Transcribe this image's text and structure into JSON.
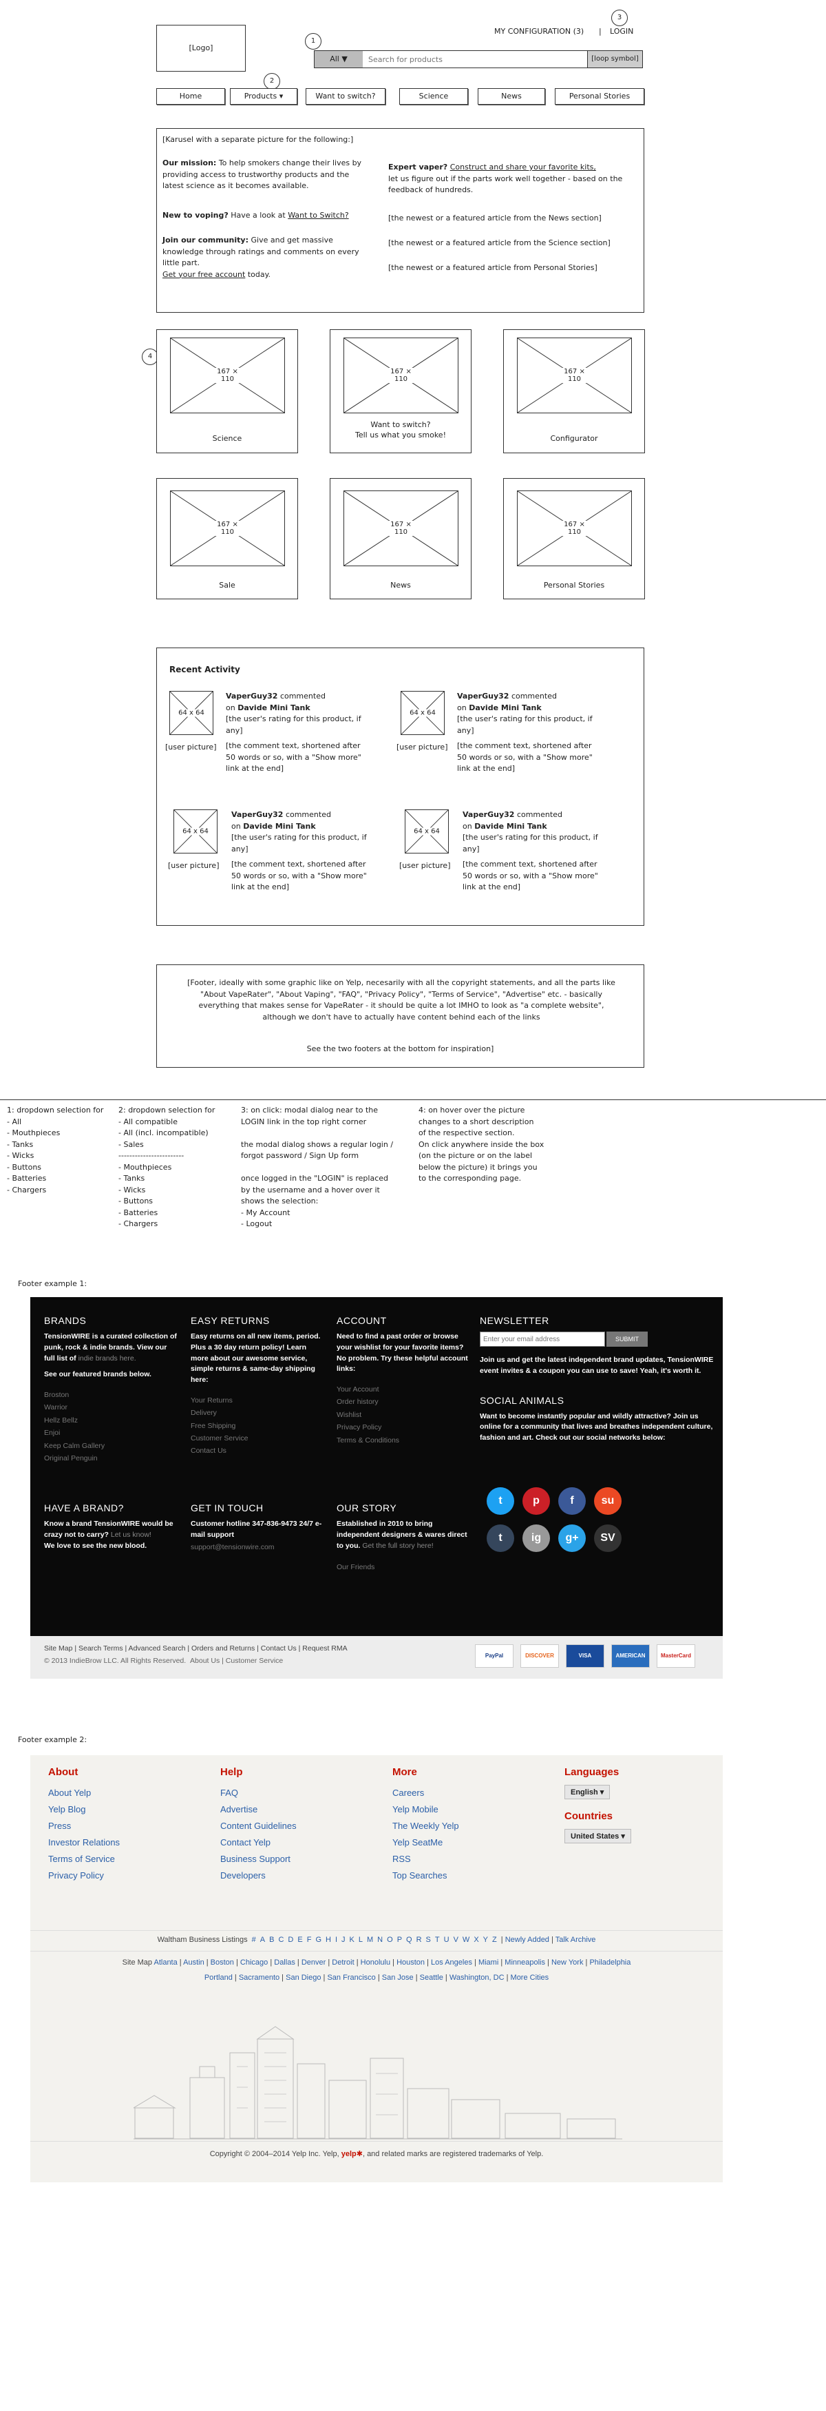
{
  "header": {
    "logo": "[Logo]",
    "my_configuration": "MY CONFIGURATION (3)",
    "separator": "|",
    "login": "LOGIN",
    "dropdown": "All",
    "search_placeholder": "Search for products",
    "search_button": "[loop symbol]"
  },
  "bubbles": {
    "b1": "1",
    "b2": "2",
    "b3": "3",
    "b4": "4"
  },
  "nav": {
    "home": "Home",
    "products": "Products",
    "switch": "Want to switch?",
    "science": "Science",
    "news": "News",
    "stories": "Personal Stories"
  },
  "hero": {
    "title": "[Karusel with a separate picture for the following:]",
    "mission_label": "Our mission:",
    "mission_text": "To help smokers change their lives by providing access to trustworthy products and the latest science as it becomes available.",
    "vaping_label": "New to voping?",
    "vaping_text": "Have a look at",
    "vaping_link": "Want to Switch?",
    "community_label": "Join our community:",
    "community_text": "Give and get massive knowledge through ratings and comments on every little part.",
    "account_link": "Get your free account",
    "account_tail": "today.",
    "expert_label": "Expert vaper?",
    "expert_link": "Construct and share your favorite kits,",
    "expert_text": "let us figure out if the parts work well together - based on the feedback of hundreds.",
    "news1": "[the newest or a featured article from the News section]",
    "news2": "[the newest or a featured article from the Science section]",
    "news3": "[the newest or a featured article from Personal Stories]"
  },
  "tiles": {
    "size": "167 × 110",
    "t1": "Science",
    "t2": "Want to switch?",
    "t2b": "Tell us what you smoke!",
    "t3": "Configurator",
    "t4": "Sale",
    "t5": "News",
    "t6": "Personal Stories"
  },
  "activity": {
    "title": "Recent Activity",
    "avatar_size": "64 x 64",
    "user_picture": "[user picture]",
    "user": "VaperGuy32",
    "commented": "commented",
    "on": "on",
    "product": "Davide Mini Tank",
    "rating": "[the user's rating for this product, if any]",
    "comment": "[the comment text, shortened after 50 words or so, with a \"Show more\" link at the end]"
  },
  "footer_note": {
    "text": "[Footer, ideally with some graphic like on Yelp, necesarily with all the copyright statements, and all the parts like \"About VapeRater\", \"About Vaping\", \"FAQ\", \"Privacy Policy\", \"Terms of Service\", \"Advertise\" etc. - basically everything that makes sense for VapeRater - it should be quite a lot IMHO to look as \"a complete website\", although we don't have to actually have content behind each of the links",
    "text2": "See the two footers at the bottom for inspiration]"
  },
  "notes": {
    "n1": [
      "1: dropdown selection for",
      "- All",
      "- Mouthpieces",
      "- Tanks",
      "- Wicks",
      "- Buttons",
      "- Batteries",
      "- Chargers"
    ],
    "n2": [
      "2: dropdown selection for",
      "- All compatible",
      "- All (incl. incompatible)",
      "- Sales",
      "------------------------",
      "- Mouthpieces",
      "- Tanks",
      "- Wicks",
      "- Buttons",
      "- Batteries",
      "- Chargers"
    ],
    "n3": [
      "3: on click: modal dialog near to the",
      "LOGIN link in the top right corner",
      "",
      "the modal dialog shows a regular login /",
      "forgot password / Sign Up form",
      "",
      "once logged in the \"LOGIN\" is replaced",
      "by the username and a hover over it",
      "shows the selection:",
      "- My Account",
      "- Logout"
    ],
    "n4": [
      "4: on hover over the picture",
      "changes to a short description",
      "of the respective section.",
      "On click anywhere inside the box",
      "(on the picture or on the label",
      "below the picture) it brings you",
      "to the corresponding page."
    ]
  },
  "footer1": {
    "label": "Footer example 1:",
    "brands_title": "BRANDS",
    "brands_text": "TensionWIRE is a curated collection of punk, rock & indie brands. View our full list of",
    "brands_link": "indie brands here.",
    "brands_feat": "See our featured brands below.",
    "brands": [
      "Broston",
      "Warrior",
      "Hellz Bellz",
      "Enjoi",
      "Keep Calm Gallery",
      "Original Penguin"
    ],
    "returns_title": "EASY RETURNS",
    "returns_text": "Easy returns on all new items, period. Plus a 30 day return policy! Learn more about our awesome service, simple returns & same-day shipping here:",
    "returns_links": [
      "Your Returns",
      "Delivery",
      "Free Shipping",
      "Customer Service",
      "Contact Us"
    ],
    "account_title": "ACCOUNT",
    "account_text": "Need to find a past order or browse your wishlist for your favorite items? No problem. Try these helpful account links:",
    "account_links": [
      "Your Account",
      "Order history",
      "Wishlist",
      "Privacy Policy",
      "Terms & Conditions"
    ],
    "newsletter_title": "NEWSLETTER",
    "newsletter_placeholder": "Enter your email address",
    "newsletter_submit": "SUBMIT",
    "newsletter_text": "Join us and get the latest independent brand updates, TensionWIRE event invites & a coupon you can use to save! Yeah, it's worth it.",
    "social_title": "SOCIAL ANIMALS",
    "social_text": "Want to become instantly popular and wildly attractive? Join us online for a community that lives and breathes independent culture, fashion and art. Check out our social networks below:",
    "brand_title": "HAVE A BRAND?",
    "brand_text": "Know a brand TensionWIRE would be crazy not to carry?",
    "brand_link": "Let us know!",
    "brand_text2": "We love to see the new blood.",
    "touch_title": "GET IN TOUCH",
    "touch_text": "Customer hotline 347-836-9473 24/7 e-mail support",
    "touch_email": "support@tensionwire.com",
    "story_title": "OUR STORY",
    "story_text": "Established in 2010 to bring independent designers & wares direct to you.",
    "story_link": "Get the full story here!",
    "friends": "Our Friends",
    "bottom_links": "Site Map | Search Terms | Advanced Search | Orders and Returns | Contact Us | Request RMA",
    "copyright": "© 2013 IndieBrow LLC. All Rights Reserved.",
    "about": "About Us",
    "cservice": "Customer Service",
    "payments": [
      "PayPal",
      "DISCOVER",
      "VISA",
      "AMERICAN EXPRESS",
      "MasterCard"
    ],
    "social_icons": [
      {
        "g": "t",
        "c": "#1da1f2"
      },
      {
        "g": "p",
        "c": "#cb2027"
      },
      {
        "g": "f",
        "c": "#3b5998"
      },
      {
        "g": "su",
        "c": "#eb4924"
      },
      {
        "g": "t",
        "c": "#35465c"
      },
      {
        "g": "ig",
        "c": "#999"
      },
      {
        "g": "g+",
        "c": "#2ba3e8"
      },
      {
        "g": "SV",
        "c": "#333"
      }
    ]
  },
  "footer2": {
    "label": "Footer example 2:",
    "about_title": "About",
    "about": [
      "About Yelp",
      "Yelp Blog",
      "Press",
      "Investor Relations",
      "Terms of Service",
      "Privacy Policy"
    ],
    "help_title": "Help",
    "help": [
      "FAQ",
      "Advertise",
      "Content Guidelines",
      "Contact Yelp",
      "Business Support",
      "Developers"
    ],
    "more_title": "More",
    "more": [
      "Careers",
      "Yelp Mobile",
      "The Weekly Yelp",
      "Yelp SeatMe",
      "RSS",
      "Top Searches"
    ],
    "languages_title": "Languages",
    "language": "English",
    "countries_title": "Countries",
    "country": "United States",
    "listings_label": "Waltham Business Listings",
    "letters": [
      "#",
      "A",
      "B",
      "C",
      "D",
      "E",
      "F",
      "G",
      "H",
      "I",
      "J",
      "K",
      "L",
      "M",
      "N",
      "O",
      "P",
      "Q",
      "R",
      "S",
      "T",
      "U",
      "V",
      "W",
      "X",
      "Y",
      "Z"
    ],
    "newly": "Newly Added",
    "talk": "Talk Archive",
    "sitemap_label": "Site Map",
    "cities1": [
      "Atlanta",
      "Austin",
      "Boston",
      "Chicago",
      "Dallas",
      "Denver",
      "Detroit",
      "Honolulu",
      "Houston",
      "Los Angeles",
      "Miami",
      "Minneapolis",
      "New York",
      "Philadelphia"
    ],
    "cities2": [
      "Portland",
      "Sacramento",
      "San Diego",
      "San Francisco",
      "San Jose",
      "Seattle",
      "Washington, DC",
      "More Cities"
    ],
    "copyright_a": "Copyright © 2004–2014 Yelp Inc. Yelp,",
    "copyright_logo": "yelp",
    "copyright_b": ", and related marks are registered trademarks of Yelp."
  }
}
